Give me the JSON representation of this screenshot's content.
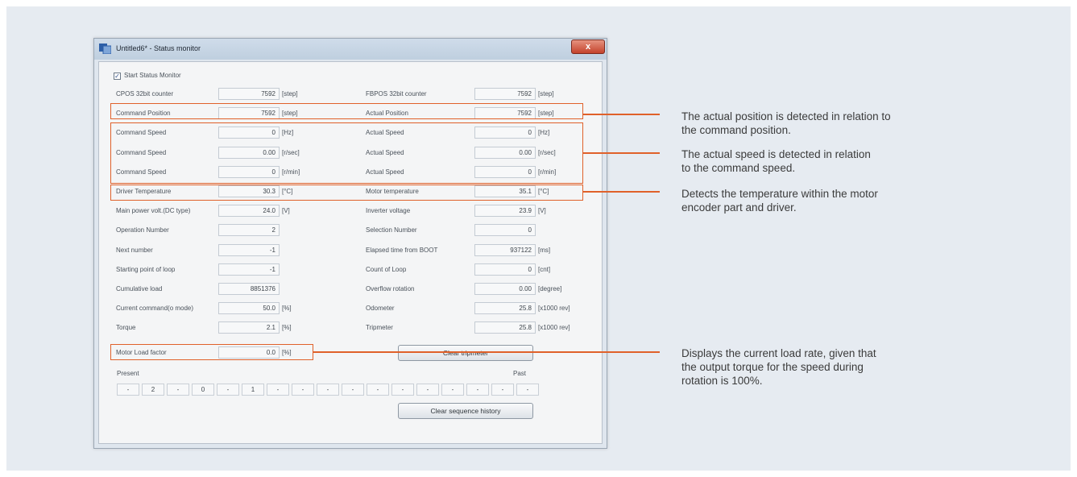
{
  "window": {
    "title": "Untitled6* - Status monitor",
    "close_glyph": "x",
    "start_monitor_label": "Start Status Monitor",
    "start_monitor_checked": true
  },
  "rows": [
    {
      "l": "CPOS 32bit counter",
      "lv": "7592",
      "lu": "[step]",
      "r": "FBPOS 32bit counter",
      "rv": "7592",
      "ru": "[step]"
    },
    {
      "l": "Command Position",
      "lv": "7592",
      "lu": "[step]",
      "r": "Actual Position",
      "rv": "7592",
      "ru": "[step]"
    },
    {
      "l": "Command Speed",
      "lv": "0",
      "lu": "[Hz]",
      "r": "Actual Speed",
      "rv": "0",
      "ru": "[Hz]"
    },
    {
      "l": "Command Speed",
      "lv": "0.00",
      "lu": "[r/sec]",
      "r": "Actual Speed",
      "rv": "0.00",
      "ru": "[r/sec]"
    },
    {
      "l": "Command Speed",
      "lv": "0",
      "lu": "[r/min]",
      "r": "Actual Speed",
      "rv": "0",
      "ru": "[r/min]"
    },
    {
      "l": "Driver Temperature",
      "lv": "30.3",
      "lu": "[°C]",
      "r": "Motor temperature",
      "rv": "35.1",
      "ru": "[°C]"
    },
    {
      "l": "Main power volt.(DC type)",
      "lv": "24.0",
      "lu": "[V]",
      "r": "Inverter voltage",
      "rv": "23.9",
      "ru": "[V]"
    },
    {
      "l": "Operation Number",
      "lv": "2",
      "lu": "",
      "r": "Selection Number",
      "rv": "0",
      "ru": ""
    },
    {
      "l": "Next number",
      "lv": "-1",
      "lu": "",
      "r": "Elapsed time from BOOT",
      "rv": "937122",
      "ru": "[ms]"
    },
    {
      "l": "Starting point of loop",
      "lv": "-1",
      "lu": "",
      "r": "Count of Loop",
      "rv": "0",
      "ru": "[cnt]"
    },
    {
      "l": "Cumulative load",
      "lv": "8851376",
      "lu": "",
      "r": "Overflow rotation",
      "rv": "0.00",
      "ru": "[degree]"
    },
    {
      "l": "Current command(o mode)",
      "lv": "50.0",
      "lu": "[%]",
      "r": "Odometer",
      "rv": "25.8",
      "ru": "[x1000 rev]"
    },
    {
      "l": "Torque",
      "lv": "2.1",
      "lu": "[%]",
      "r": "Tripmeter",
      "rv": "25.8",
      "ru": "[x1000 rev]"
    }
  ],
  "motor_load": {
    "label": "Motor Load factor",
    "value": "0.0",
    "unit": "[%]"
  },
  "buttons": {
    "clear_tripmeter": "Clear tripmeter",
    "clear_sequence": "Clear sequence history"
  },
  "sequence": {
    "present_label": "Present",
    "past_label": "Past",
    "cells": [
      "-",
      "2",
      "-",
      "0",
      "-",
      "1",
      "-",
      "-",
      "-",
      "-",
      "-",
      "-",
      "-",
      "-",
      "-",
      "-",
      "-"
    ]
  },
  "annotations": {
    "position": [
      "The actual position is detected in relation to",
      "the command position."
    ],
    "speed": [
      "The actual speed is detected in relation",
      "to the command speed."
    ],
    "temperature": [
      "Detects the temperature within the motor",
      "encoder part and driver."
    ],
    "load": [
      "Displays the current load rate, given that",
      "the output torque for the speed during",
      "rotation is 100%."
    ]
  },
  "colors": {
    "panel_bg": "#e6ebf1",
    "highlight": "#e0612a",
    "close_button": "#c4432c"
  }
}
